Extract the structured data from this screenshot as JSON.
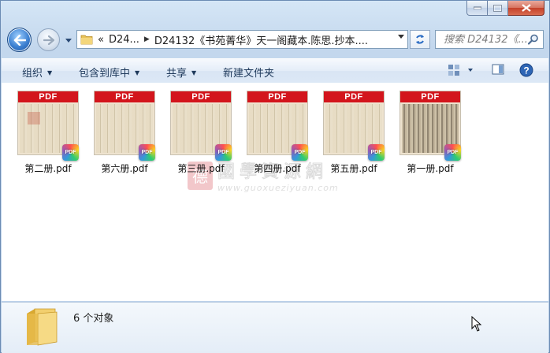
{
  "window": {
    "caption_buttons": [
      "minimize",
      "maximize",
      "close"
    ]
  },
  "nav": {
    "back_icon": "back-arrow-icon",
    "forward_icon": "forward-arrow-icon"
  },
  "address": {
    "overflow": "«",
    "crumbs": [
      "D24...",
      "D24132《书苑菁华》天一阁藏本.陈思.抄本...."
    ]
  },
  "search": {
    "placeholder": "搜索 D24132《..."
  },
  "commands": {
    "organize": "组织",
    "include_in_library": "包含到库中",
    "share": "共享",
    "new_folder": "新建文件夹"
  },
  "files": [
    {
      "name": "第二册.pdf",
      "badge": "PDF",
      "tag": "PDF",
      "style": "seal"
    },
    {
      "name": "第六册.pdf",
      "badge": "PDF",
      "tag": "PDF",
      "style": "light"
    },
    {
      "name": "第三册.pdf",
      "badge": "PDF",
      "tag": "PDF",
      "style": "light"
    },
    {
      "name": "第四册.pdf",
      "badge": "PDF",
      "tag": "PDF",
      "style": "light"
    },
    {
      "name": "第五册.pdf",
      "badge": "PDF",
      "tag": "PDF",
      "style": "light"
    },
    {
      "name": "第一册.pdf",
      "badge": "PDF",
      "tag": "PDF",
      "style": "dark"
    }
  ],
  "watermark": {
    "logo": "德",
    "text": "國學資源網",
    "url": "www.guoxueziyuan.com"
  },
  "details": {
    "count": "6 个对象"
  },
  "colors": {
    "pdf_banner": "#d3151c",
    "accent": "#1e395b"
  }
}
